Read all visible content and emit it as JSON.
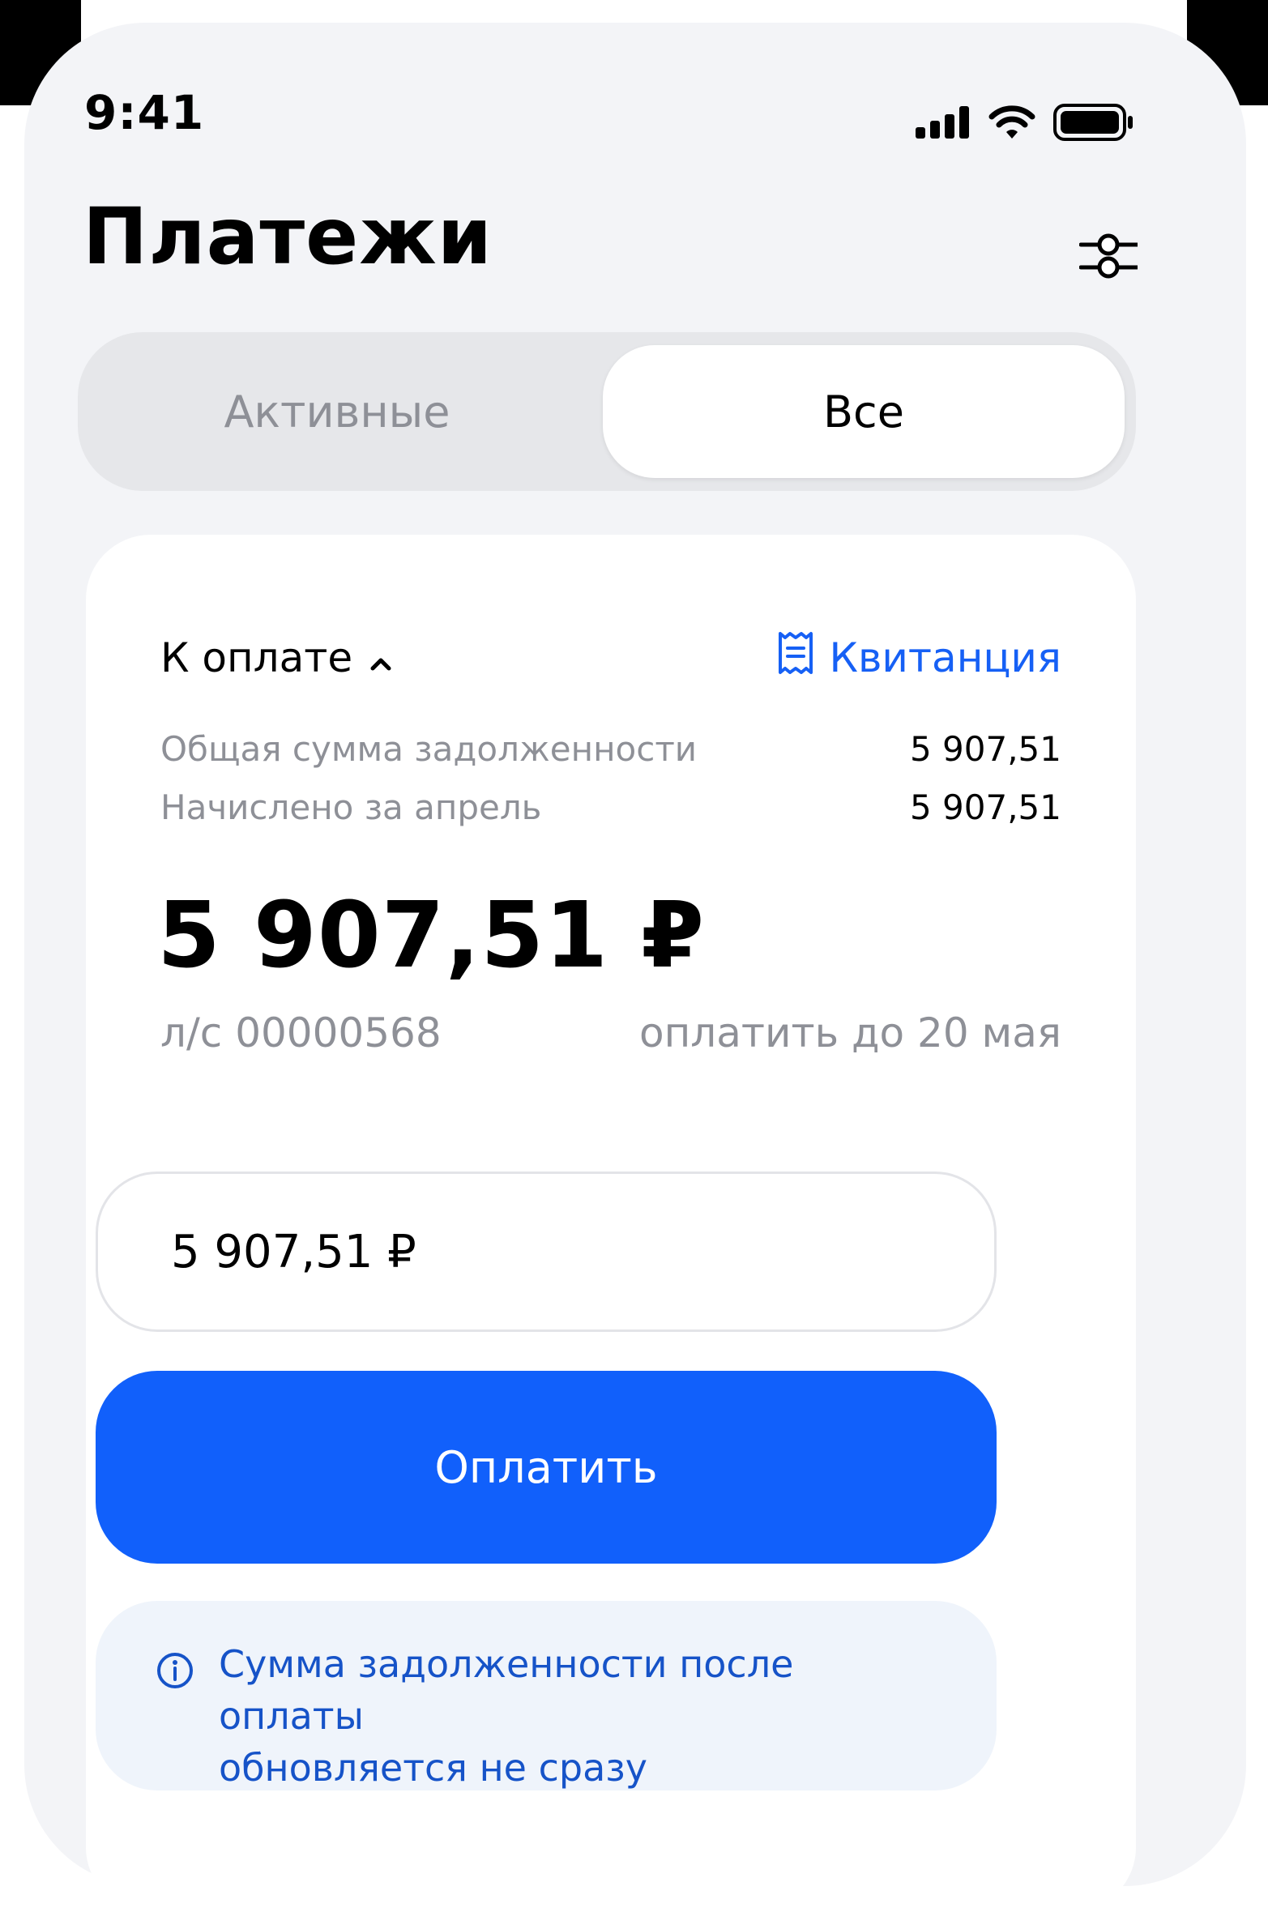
{
  "status_bar": {
    "time": "9:41"
  },
  "header": {
    "title": "Платежи"
  },
  "tabs": [
    {
      "label": "Активные",
      "selected": false
    },
    {
      "label": "Все",
      "selected": true
    }
  ],
  "card": {
    "due_label": "К оплате",
    "receipt_label": "Квитанция",
    "summary": [
      {
        "label": "Общая сумма задолженности",
        "value": "5 907,51"
      },
      {
        "label": "Начислено за апрель",
        "value": "5 907,51"
      }
    ],
    "amount": "5 907,51 ₽",
    "account": "л/с 00000568",
    "due_date": "оплатить до 20 мая",
    "input_value": "5 907,51 ₽",
    "pay_button": "Оплатить",
    "info_line1": "Сумма задолженности после оплаты",
    "info_line2": "обновляется не сразу"
  },
  "icons": {
    "signal": "cellular-signal-icon",
    "wifi": "wifi-icon",
    "battery": "battery-icon",
    "filter": "filter-sliders-icon",
    "chevron": "chevron-up-icon",
    "receipt": "receipt-icon",
    "info": "info-icon"
  },
  "colors": {
    "accent": "#1160fb",
    "link": "#1660f5",
    "info_text": "#1653c8",
    "info_bg": "#eff4fb",
    "muted_text": "#8e9097",
    "screen_bg": "#f3f4f7"
  }
}
